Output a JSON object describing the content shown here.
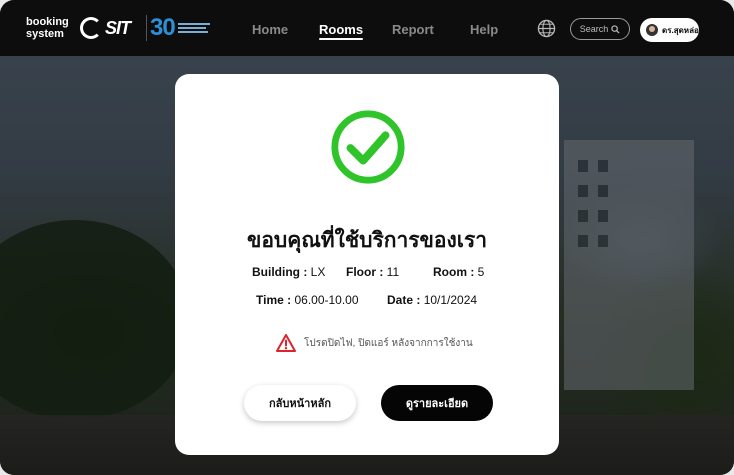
{
  "navbar": {
    "brand_line1": "booking",
    "brand_line2": "system",
    "logo_sit_text": "SIT",
    "logo_30_text": "30",
    "links": [
      {
        "label": "Home",
        "active": false
      },
      {
        "label": "Rooms",
        "active": true
      },
      {
        "label": "Report",
        "active": false
      },
      {
        "label": "Help",
        "active": false
      }
    ],
    "search_placeholder": "Search",
    "user_name": "ดร.สุดหล่อ"
  },
  "modal": {
    "title": "ขอบคุณที่ใช้บริการของเรา",
    "building_label": "Building :",
    "building_value": "LX",
    "floor_label": "Floor :",
    "floor_value": "11",
    "room_label": "Room :",
    "room_value": "5",
    "time_label": "Time :",
    "time_value": "06.00-10.00",
    "date_label": "Date :",
    "date_value": "10/1/2024",
    "warning_text": "โปรดปิดไฟ, ปิดแอร์ หลังจากการใช้งาน",
    "back_button": "กลับหน้าหลัก",
    "detail_button": "ดูรายละเอียด"
  },
  "colors": {
    "check_green": "#2fc52a",
    "warning_red": "#d9262c",
    "navbar_bg": "#0d0d0d",
    "accent_blue": "#2f8fd6"
  },
  "icons": [
    "globe-icon",
    "search-icon",
    "avatar",
    "check-circle-icon",
    "warning-icon"
  ]
}
